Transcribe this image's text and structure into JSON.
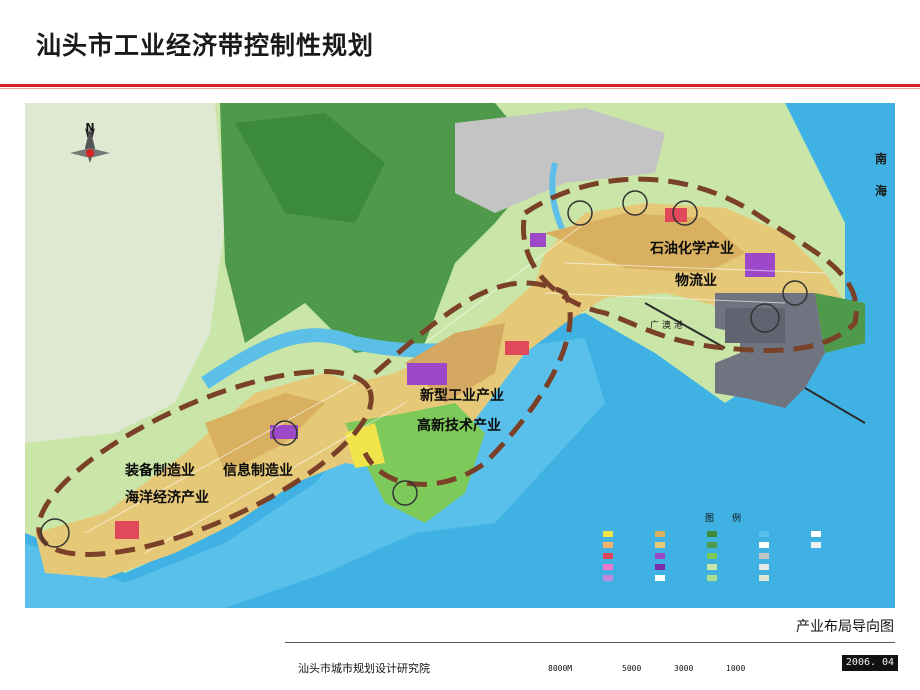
{
  "slide": {
    "title": "汕头市工业经济带控制性规划",
    "caption": "产业布局导向图",
    "institute": "汕头市城市规划设计研究院",
    "date": "2006. 04"
  },
  "map": {
    "north_label": "N",
    "sea_labels": [
      "南",
      "海"
    ],
    "harbor_label": "广 澳 港",
    "industry_zones": [
      "石油化学产业",
      "物流业",
      "新型工业产业",
      "高新技术产业",
      "装备制造业",
      "信息制造业",
      "海洋经济产业"
    ],
    "legend_title": "图　　例",
    "scale_labels": [
      "8000M",
      "5000",
      "3000",
      "1000"
    ]
  }
}
